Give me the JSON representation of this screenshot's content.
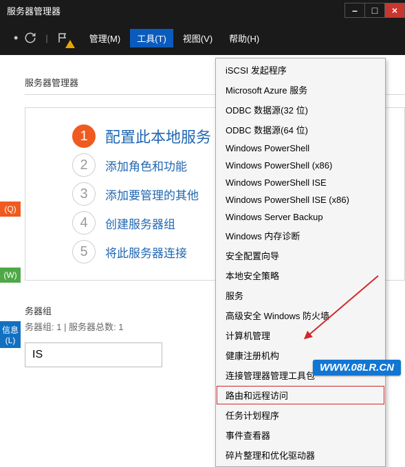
{
  "window": {
    "title": "服务器管理器",
    "minimize": "–",
    "maximize": "□",
    "close": "×"
  },
  "menubar": {
    "manage": "管理(M)",
    "tools": "工具(T)",
    "view": "视图(V)",
    "help": "帮助(H)"
  },
  "subtitle": "服务器管理器",
  "sidebar": {
    "q": "(Q)",
    "w": "(W)",
    "l": "信息(L)"
  },
  "steps": [
    {
      "num": "1",
      "label": "配置此本地服务",
      "active": true
    },
    {
      "num": "2",
      "label": "添加角色和功能",
      "active": false
    },
    {
      "num": "3",
      "label": "添加要管理的其他",
      "active": false
    },
    {
      "num": "4",
      "label": "创建服务器组",
      "active": false
    },
    {
      "num": "5",
      "label": "将此服务器连接",
      "active": false
    }
  ],
  "groups": {
    "title": "务器组",
    "meta": "务器组: 1 | 服务器总数: 1",
    "iis": "IS"
  },
  "tools_menu": {
    "tail": "",
    "items": [
      "iSCSI 发起程序",
      "Microsoft Azure 服务",
      "ODBC 数据源(32 位)",
      "ODBC 数据源(64 位)",
      "Windows PowerShell",
      "Windows PowerShell (x86)",
      "Windows PowerShell ISE",
      "Windows PowerShell ISE (x86)",
      "Windows Server Backup",
      "Windows 内存诊断",
      "安全配置向导",
      "本地安全策略",
      "服务",
      "高级安全 Windows 防火墙",
      "计算机管理",
      "健康注册机构",
      "连接管理器管理工具包",
      "路由和远程访问",
      "任务计划程序",
      "事件查看器",
      "碎片整理和优化驱动器"
    ],
    "highlight_index": 17
  },
  "watermark": "WWW.08LR.CN"
}
